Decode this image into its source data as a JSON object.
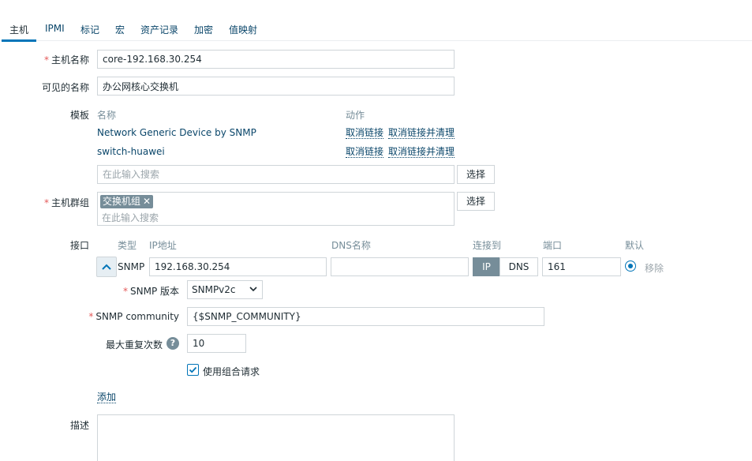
{
  "tabs": [
    {
      "label": "主机"
    },
    {
      "label": "IPMI"
    },
    {
      "label": "标记"
    },
    {
      "label": "宏"
    },
    {
      "label": "资产记录"
    },
    {
      "label": "加密"
    },
    {
      "label": "值映射"
    }
  ],
  "host_name": {
    "label": "主机名称",
    "value": "core-192.168.30.254"
  },
  "visible_name": {
    "label": "可见的名称",
    "value": "办公网核心交换机"
  },
  "templates": {
    "label": "模板",
    "col_name": "名称",
    "col_action": "动作",
    "items": [
      {
        "name": "Network Generic Device by SNMP",
        "unlink": "取消链接",
        "unlink_clear": "取消链接并清理"
      },
      {
        "name": "switch-huawei",
        "unlink": "取消链接",
        "unlink_clear": "取消链接并清理"
      }
    ],
    "search_placeholder": "在此输入搜索",
    "select_label": "选择"
  },
  "host_groups": {
    "label": "主机群组",
    "chip": "交换机组",
    "chip_remove": "✕",
    "placeholder": "在此输入搜索",
    "select_label": "选择"
  },
  "interfaces": {
    "label": "接口",
    "headers": {
      "type": "类型",
      "ip": "IP地址",
      "dns": "DNS名称",
      "connect": "连接到",
      "port": "端口",
      "default": "默认"
    },
    "row": {
      "type": "SNMP",
      "ip": "192.168.30.254",
      "dns": "",
      "connect_ip": "IP",
      "connect_dns": "DNS",
      "port": "161",
      "remove": "移除"
    },
    "snmp_version": {
      "label": "SNMP 版本",
      "value": "SNMPv2c"
    },
    "snmp_community": {
      "label": "SNMP community",
      "value": "{$SNMP_COMMUNITY}"
    },
    "max_repetitions": {
      "label": "最大重复次数",
      "help": "?",
      "value": "10"
    },
    "bulk": {
      "label": "使用组合请求",
      "checked": true
    },
    "add": "添加"
  },
  "description": {
    "label": "描述",
    "value": ""
  },
  "required_mark": "*"
}
